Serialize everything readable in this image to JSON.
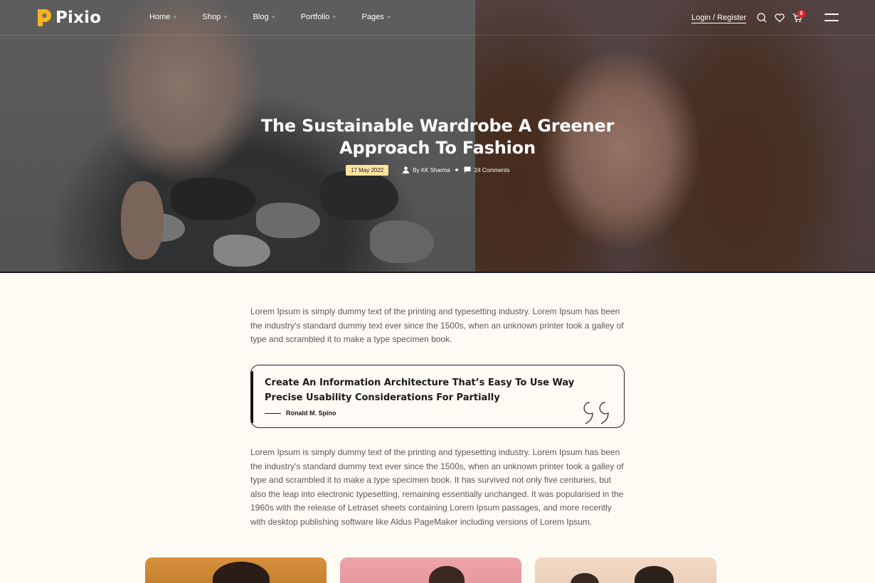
{
  "brand": {
    "name": "Pixio",
    "logo_color": "#f8b41e"
  },
  "nav": {
    "items": [
      {
        "label": "Home",
        "icon": "plus-icon"
      },
      {
        "label": "Shop",
        "icon": "plus-icon"
      },
      {
        "label": "Blog",
        "icon": "plus-icon"
      },
      {
        "label": "Portfolio",
        "icon": "plus-icon"
      },
      {
        "label": "Pages",
        "icon": "plus-icon"
      }
    ],
    "login_label": "Login / Register",
    "cart_count": "5",
    "icons": [
      "search-icon",
      "heart-icon",
      "cart-icon",
      "menu-icon"
    ]
  },
  "post": {
    "title": "The Sustainable Wardrobe A Greener Approach To Fashion",
    "date": "17 May 2022",
    "author": "By KK Sharma",
    "comments": "24 Comments"
  },
  "content": {
    "paragraph1": "Lorem Ipsum is simply dummy text of the printing and typesetting industry. Lorem Ipsum has been the industry's standard dummy text ever since the 1500s, when an unknown printer took a galley of type and scrambled it to make a type specimen book.",
    "quote_text": "Create An Information Architecture That’s Easy To Use Way Precise Usability Considerations For Partially",
    "quote_author": "Ronald M. Spino",
    "paragraph2": "Lorem Ipsum is simply dummy text of the printing and typesetting industry. Lorem Ipsum has been the industry's standard dummy text ever since the 1500s, when an unknown printer took a galley of type and scrambled it to make a type specimen book. It has survived not only five centuries, but also the leap into electronic typesetting, remaining essentially unchanged. It was popularised in the 1960s with the release of Letraset sheets containing Lorem Ipsum passages, and more recently with desktop publishing software like Aldus PageMaker including versions of Lorem Ipsum."
  },
  "colors": {
    "page_bg": "#fefaf4",
    "date_pill": "#fbe3a0",
    "badge": "#e4222a",
    "body_text": "#5a5a5a"
  }
}
